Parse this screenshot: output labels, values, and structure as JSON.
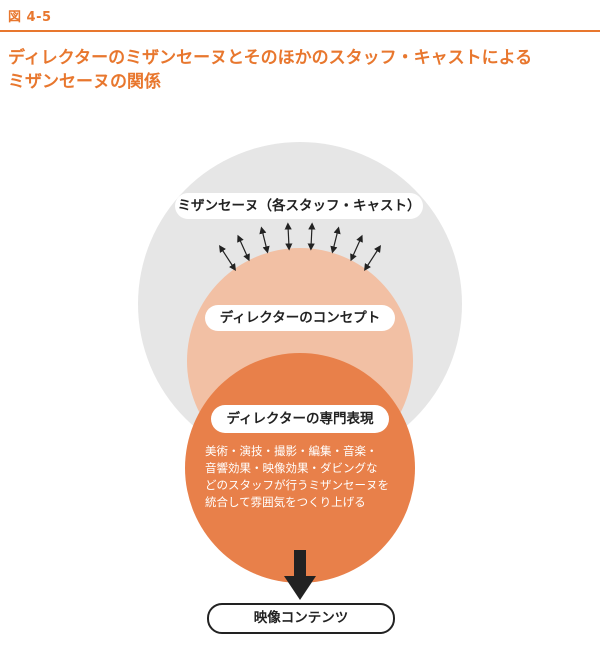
{
  "figure": {
    "label": "図 4-5",
    "title_lines": [
      "ディレクターのミザンセーヌとそのほかのスタッフ・キャストによる",
      "ミザンセーヌの関係"
    ]
  },
  "diagram": {
    "outer_label": "ミザンセーヌ（各スタッフ・キャスト）",
    "middle_label": "ディレクターのコンセプト",
    "inner_label": "ディレクターの専門表現",
    "inner_description_lines": [
      "美術・演技・撮影・編集・音楽・",
      "音響効果・映像効果・ダビングな",
      "どのスタッフが行うミザンセーヌを",
      "統合して雰囲気をつくり上げる"
    ],
    "output_label": "映像コンテンツ",
    "colors": {
      "accent": "#e8772e",
      "outer_circle": "#e6e6e6",
      "middle_circle": "#f2c0a4",
      "inner_circle": "#e8804a",
      "ink": "#222222"
    }
  }
}
